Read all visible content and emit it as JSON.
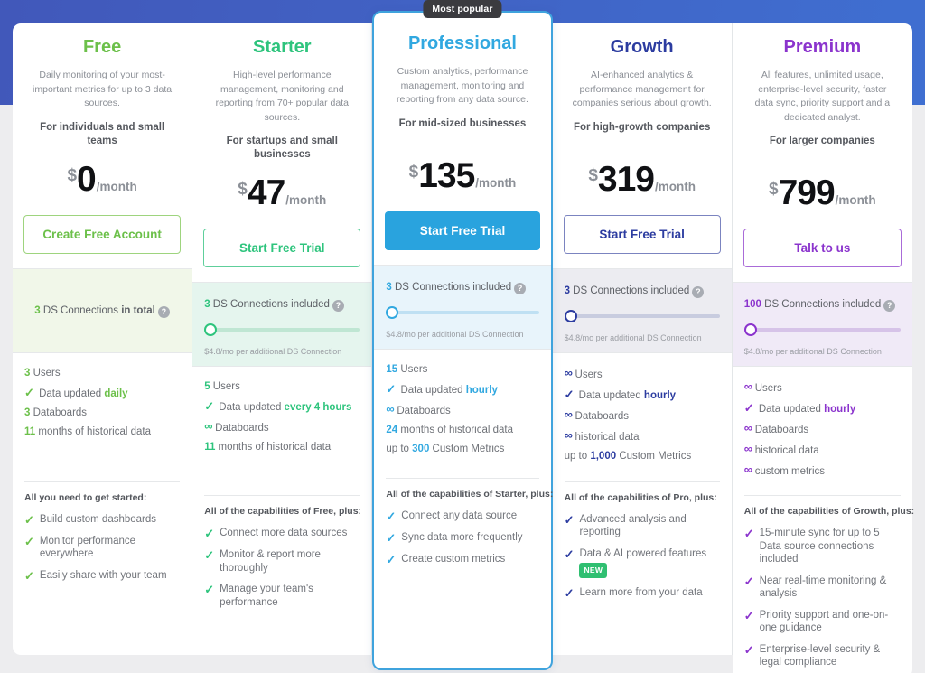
{
  "badge": {
    "most_popular": "Most popular"
  },
  "help_icon_char": "?",
  "tick_char": "✓",
  "infinity_char": "∞",
  "currency_symbol": "$",
  "period_label": "/month",
  "plans": [
    {
      "name": "Free",
      "color": "#6cc04a",
      "track_color": "#d7ebc8",
      "band_bg": "#f1f7e9",
      "knob_border": "#6cc04a",
      "description": "Daily monitoring of your most-important metrics for up to 3 data sources.",
      "audience": "For individuals and small teams",
      "price": "0",
      "cta_label": "Create Free Account",
      "cta_style": "outline",
      "cta_color": "#6cc04a",
      "cta_border": "#9ed47e",
      "ds": {
        "layout": "centered",
        "count": "3",
        "label_rest": " DS Connections ",
        "label_strong": "in total",
        "note": ""
      },
      "specs": [
        {
          "lead": "3",
          "text": " Users"
        },
        {
          "tick": true,
          "text": "Data updated ",
          "hi": "daily"
        },
        {
          "lead": "3",
          "text": " Databoards"
        },
        {
          "lead": "11",
          "text": "  months of historical data"
        }
      ],
      "benefits_title": "All you need to get started:",
      "benefits": [
        {
          "text": "Build custom dashboards"
        },
        {
          "text": "Monitor performance everywhere"
        },
        {
          "text": "Easily share with your team"
        }
      ]
    },
    {
      "name": "Starter",
      "color": "#2ec47d",
      "track_color": "#bfe6d3",
      "band_bg": "#e5f5ee",
      "knob_border": "#2ec47d",
      "description": "High-level performance management, monitoring and reporting from 70+ popular data sources.",
      "audience": "For startups and small businesses",
      "price": "47",
      "cta_label": "Start Free Trial",
      "cta_style": "outline",
      "cta_color": "#2ec47d",
      "cta_border": "#5ecf9b",
      "ds": {
        "layout": "slider",
        "count": "3",
        "label_rest": " DS Connections included",
        "note": "$4.8/mo per additional DS Connection"
      },
      "specs": [
        {
          "lead": "5",
          "text": " Users"
        },
        {
          "tick": true,
          "text": "Data updated ",
          "hi": "every 4 hours"
        },
        {
          "inf": true,
          "text": " Databoards"
        },
        {
          "lead": "11",
          "text": "  months of historical data"
        }
      ],
      "benefits_title": "All of the capabilities of Free, plus:",
      "benefits": [
        {
          "text": "Connect more data sources"
        },
        {
          "text": "Monitor & report more thoroughly"
        },
        {
          "text": "Manage your team's performance"
        }
      ]
    },
    {
      "name": "Professional",
      "color": "#31a8e0",
      "track_color": "#bfe0f3",
      "band_bg": "#e8f4fb",
      "knob_border": "#31a8e0",
      "featured": true,
      "description": "Custom analytics, performance management, monitoring and reporting from any data source.",
      "audience": "For mid-sized businesses",
      "price": "135",
      "cta_label": "Start Free Trial",
      "cta_style": "solid",
      "cta_color": "#ffffff",
      "cta_bg": "#29a3de",
      "ds": {
        "layout": "slider",
        "count": "3",
        "label_rest": " DS Connections included",
        "note": "$4.8/mo per additional DS Connection"
      },
      "specs": [
        {
          "lead": "15",
          "text": " Users"
        },
        {
          "tick": true,
          "text": "Data updated ",
          "hi": "hourly"
        },
        {
          "inf": true,
          "text": " Databoards"
        },
        {
          "lead": "24",
          "text": "  months of historical data"
        },
        {
          "pre": "up to ",
          "hi2": "300",
          "text": " Custom Metrics"
        }
      ],
      "benefits_title": "All of the capabilities of Starter, plus:",
      "benefits": [
        {
          "text": "Connect any data source"
        },
        {
          "text": "Sync data more frequently"
        },
        {
          "text": "Create custom metrics"
        }
      ]
    },
    {
      "name": "Growth",
      "color": "#2c3ca0",
      "track_color": "#c8ccdf",
      "band_bg": "#ececf1",
      "knob_border": "#2c3ca0",
      "description": "AI-enhanced analytics & performance management for companies serious about growth.",
      "audience": "For high-growth companies",
      "price": "319",
      "cta_label": "Start Free Trial",
      "cta_style": "outline",
      "cta_color": "#2c3ca0",
      "cta_border": "#7b84c0",
      "ds": {
        "layout": "slider",
        "count": "3",
        "label_rest": " DS Connections included",
        "note": "$4.8/mo per additional DS Connection"
      },
      "specs": [
        {
          "inf": true,
          "text": " Users"
        },
        {
          "tick": true,
          "text": "Data updated ",
          "hi": "hourly"
        },
        {
          "inf": true,
          "text": " Databoards"
        },
        {
          "inf": true,
          "text": " historical data"
        },
        {
          "pre": "up to ",
          "hi2": "1,000",
          "text": " Custom Metrics"
        }
      ],
      "benefits_title": "All of the capabilities of Pro, plus:",
      "benefits": [
        {
          "text": "Advanced analysis and reporting"
        },
        {
          "text": "Data & AI powered features",
          "badge": "NEW"
        },
        {
          "text": "Learn more from your data"
        }
      ]
    },
    {
      "name": "Premium",
      "color": "#8b34cd",
      "track_color": "#d6c3e8",
      "band_bg": "#f0eaf7",
      "knob_border": "#8b34cd",
      "description": "All features, unlimited usage, enterprise-level security, faster data sync, priority support and a dedicated analyst.",
      "audience": "For larger companies",
      "price": "799",
      "cta_label": "Talk to us",
      "cta_style": "outline",
      "cta_color": "#8b34cd",
      "cta_border": "#a96bd8",
      "ds": {
        "layout": "slider",
        "count": "100",
        "label_rest": " DS Connections included",
        "note": "$4.8/mo per additional DS Connection"
      },
      "specs": [
        {
          "inf": true,
          "text": " Users"
        },
        {
          "tick": true,
          "text": "Data updated ",
          "hi": "hourly"
        },
        {
          "inf": true,
          "text": " Databoards"
        },
        {
          "inf": true,
          "text": " historical data"
        },
        {
          "inf": true,
          "text": " custom metrics"
        }
      ],
      "benefits_title": "All of the capabilities of Growth, plus:",
      "benefits": [
        {
          "text": "15-minute sync for up to 5 Data source connections included"
        },
        {
          "text": "Near real-time monitoring & analysis"
        },
        {
          "text": "Priority support and one-on-one guidance"
        },
        {
          "text": "Enterprise-level security & legal compliance"
        }
      ]
    }
  ]
}
